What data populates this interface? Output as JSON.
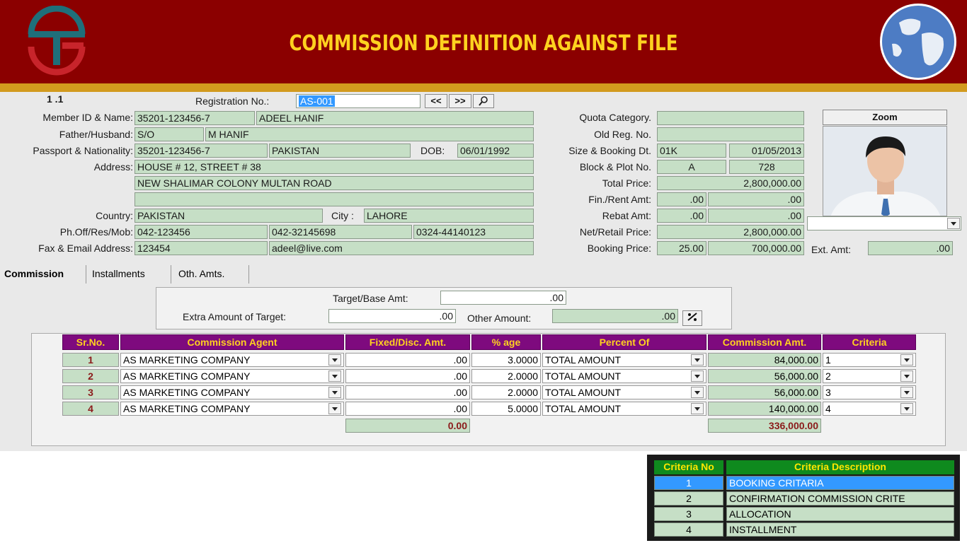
{
  "header": {
    "title": "COMMISSION DEFINITION AGAINST FILE",
    "brand_color": "#8b0000",
    "accent_color": "#ffd21f"
  },
  "form": {
    "record_no": "1 .1",
    "reg_label": "Registration No.:",
    "reg_value": "AS-001",
    "nav_prev": "<<",
    "nav_next": ">>",
    "labels": {
      "member": "Member ID & Name:",
      "father": "Father/Husband:",
      "passport": "Passport & Nationality:",
      "dob": "DOB:",
      "address": "Address:",
      "country": "Country:",
      "city": "City :",
      "phone": "Ph.Off/Res/Mob:",
      "fax": "Fax & Email Address:",
      "quota": "Quota Category.",
      "oldreg": "Old Reg. No.",
      "size": "Size & Booking Dt.",
      "block": "Block & Plot No.",
      "total_price": "Total Price:",
      "fin": "Fin./Rent Amt:",
      "rebat": "Rebat Amt:",
      "net": "Net/Retail Price:",
      "booking": "Booking Price:",
      "ext": "Ext. Amt:",
      "zoom": "Zoom"
    },
    "values": {
      "member_id": "35201-123456-7",
      "member_name": "ADEEL HANIF",
      "relation": "S/O",
      "father_name": "M HANIF",
      "passport": "35201-123456-7",
      "nationality": "PAKISTAN",
      "dob": "06/01/1992",
      "address1": "HOUSE # 12, STREET # 38",
      "address2": "NEW SHALIMAR COLONY MULTAN ROAD",
      "address3": "",
      "country": "PAKISTAN",
      "city": "LAHORE",
      "ph_off": "042-123456",
      "ph_res": "042-32145698",
      "ph_mob": "0324-44140123",
      "fax": "123454",
      "email": "adeel@live.com",
      "quota": "",
      "oldreg": "",
      "size": "01K",
      "booking_dt": "01/05/2013",
      "block": "A",
      "plot": "728",
      "total_price": "2,800,000.00",
      "fin_a": ".00",
      "fin_b": ".00",
      "rebat_a": ".00",
      "rebat_b": ".00",
      "net_price": "2,800,000.00",
      "booking_pct": "25.00",
      "booking_price": "700,000.00",
      "ext_amt": ".00"
    }
  },
  "tabs": [
    {
      "label": "Commission"
    },
    {
      "label": "Installments"
    },
    {
      "label": "Oth. Amts."
    }
  ],
  "target": {
    "target_label": "Target/Base Amt:",
    "target_value": ".00",
    "extra_label": "Extra Amount of Target:",
    "extra_value": ".00",
    "other_label": "Other Amount:",
    "other_value": ".00"
  },
  "grid": {
    "headers": [
      "Sr.No.",
      "Commission Agent",
      "Fixed/Disc.  Amt.",
      "% age",
      "Percent Of",
      "Commission Amt.",
      "Criteria"
    ],
    "rows": [
      {
        "sr": "1",
        "agent": "AS MARKETING COMPANY",
        "fixed": ".00",
        "pct": "3.0000",
        "of": "TOTAL AMOUNT",
        "amt": "84,000.00",
        "crit": "1"
      },
      {
        "sr": "2",
        "agent": "AS MARKETING COMPANY",
        "fixed": ".00",
        "pct": "2.0000",
        "of": "TOTAL AMOUNT",
        "amt": "56,000.00",
        "crit": "2"
      },
      {
        "sr": "3",
        "agent": "AS MARKETING COMPANY",
        "fixed": ".00",
        "pct": "2.0000",
        "of": "TOTAL AMOUNT",
        "amt": "56,000.00",
        "crit": "3"
      },
      {
        "sr": "4",
        "agent": "AS MARKETING COMPANY",
        "fixed": ".00",
        "pct": "5.0000",
        "of": "TOTAL AMOUNT",
        "amt": "140,000.00",
        "crit": "4"
      }
    ],
    "total_fixed": "0.00",
    "total_amt": "336,000.00"
  },
  "criteria": {
    "headers": [
      "Criteria No",
      "Criteria Description"
    ],
    "rows": [
      {
        "no": "1",
        "desc": "BOOKING CRITARIA"
      },
      {
        "no": "2",
        "desc": "CONFIRMATION COMMISSION CRITE"
      },
      {
        "no": "3",
        "desc": "ALLOCATION"
      },
      {
        "no": "4",
        "desc": "INSTALLMENT"
      }
    ]
  },
  "icons": {
    "logo": "company-logo-icon",
    "globe": "globe-icon",
    "search": "search-icon",
    "calc": "calculator-icon",
    "dropdown": "chevron-down-icon"
  }
}
